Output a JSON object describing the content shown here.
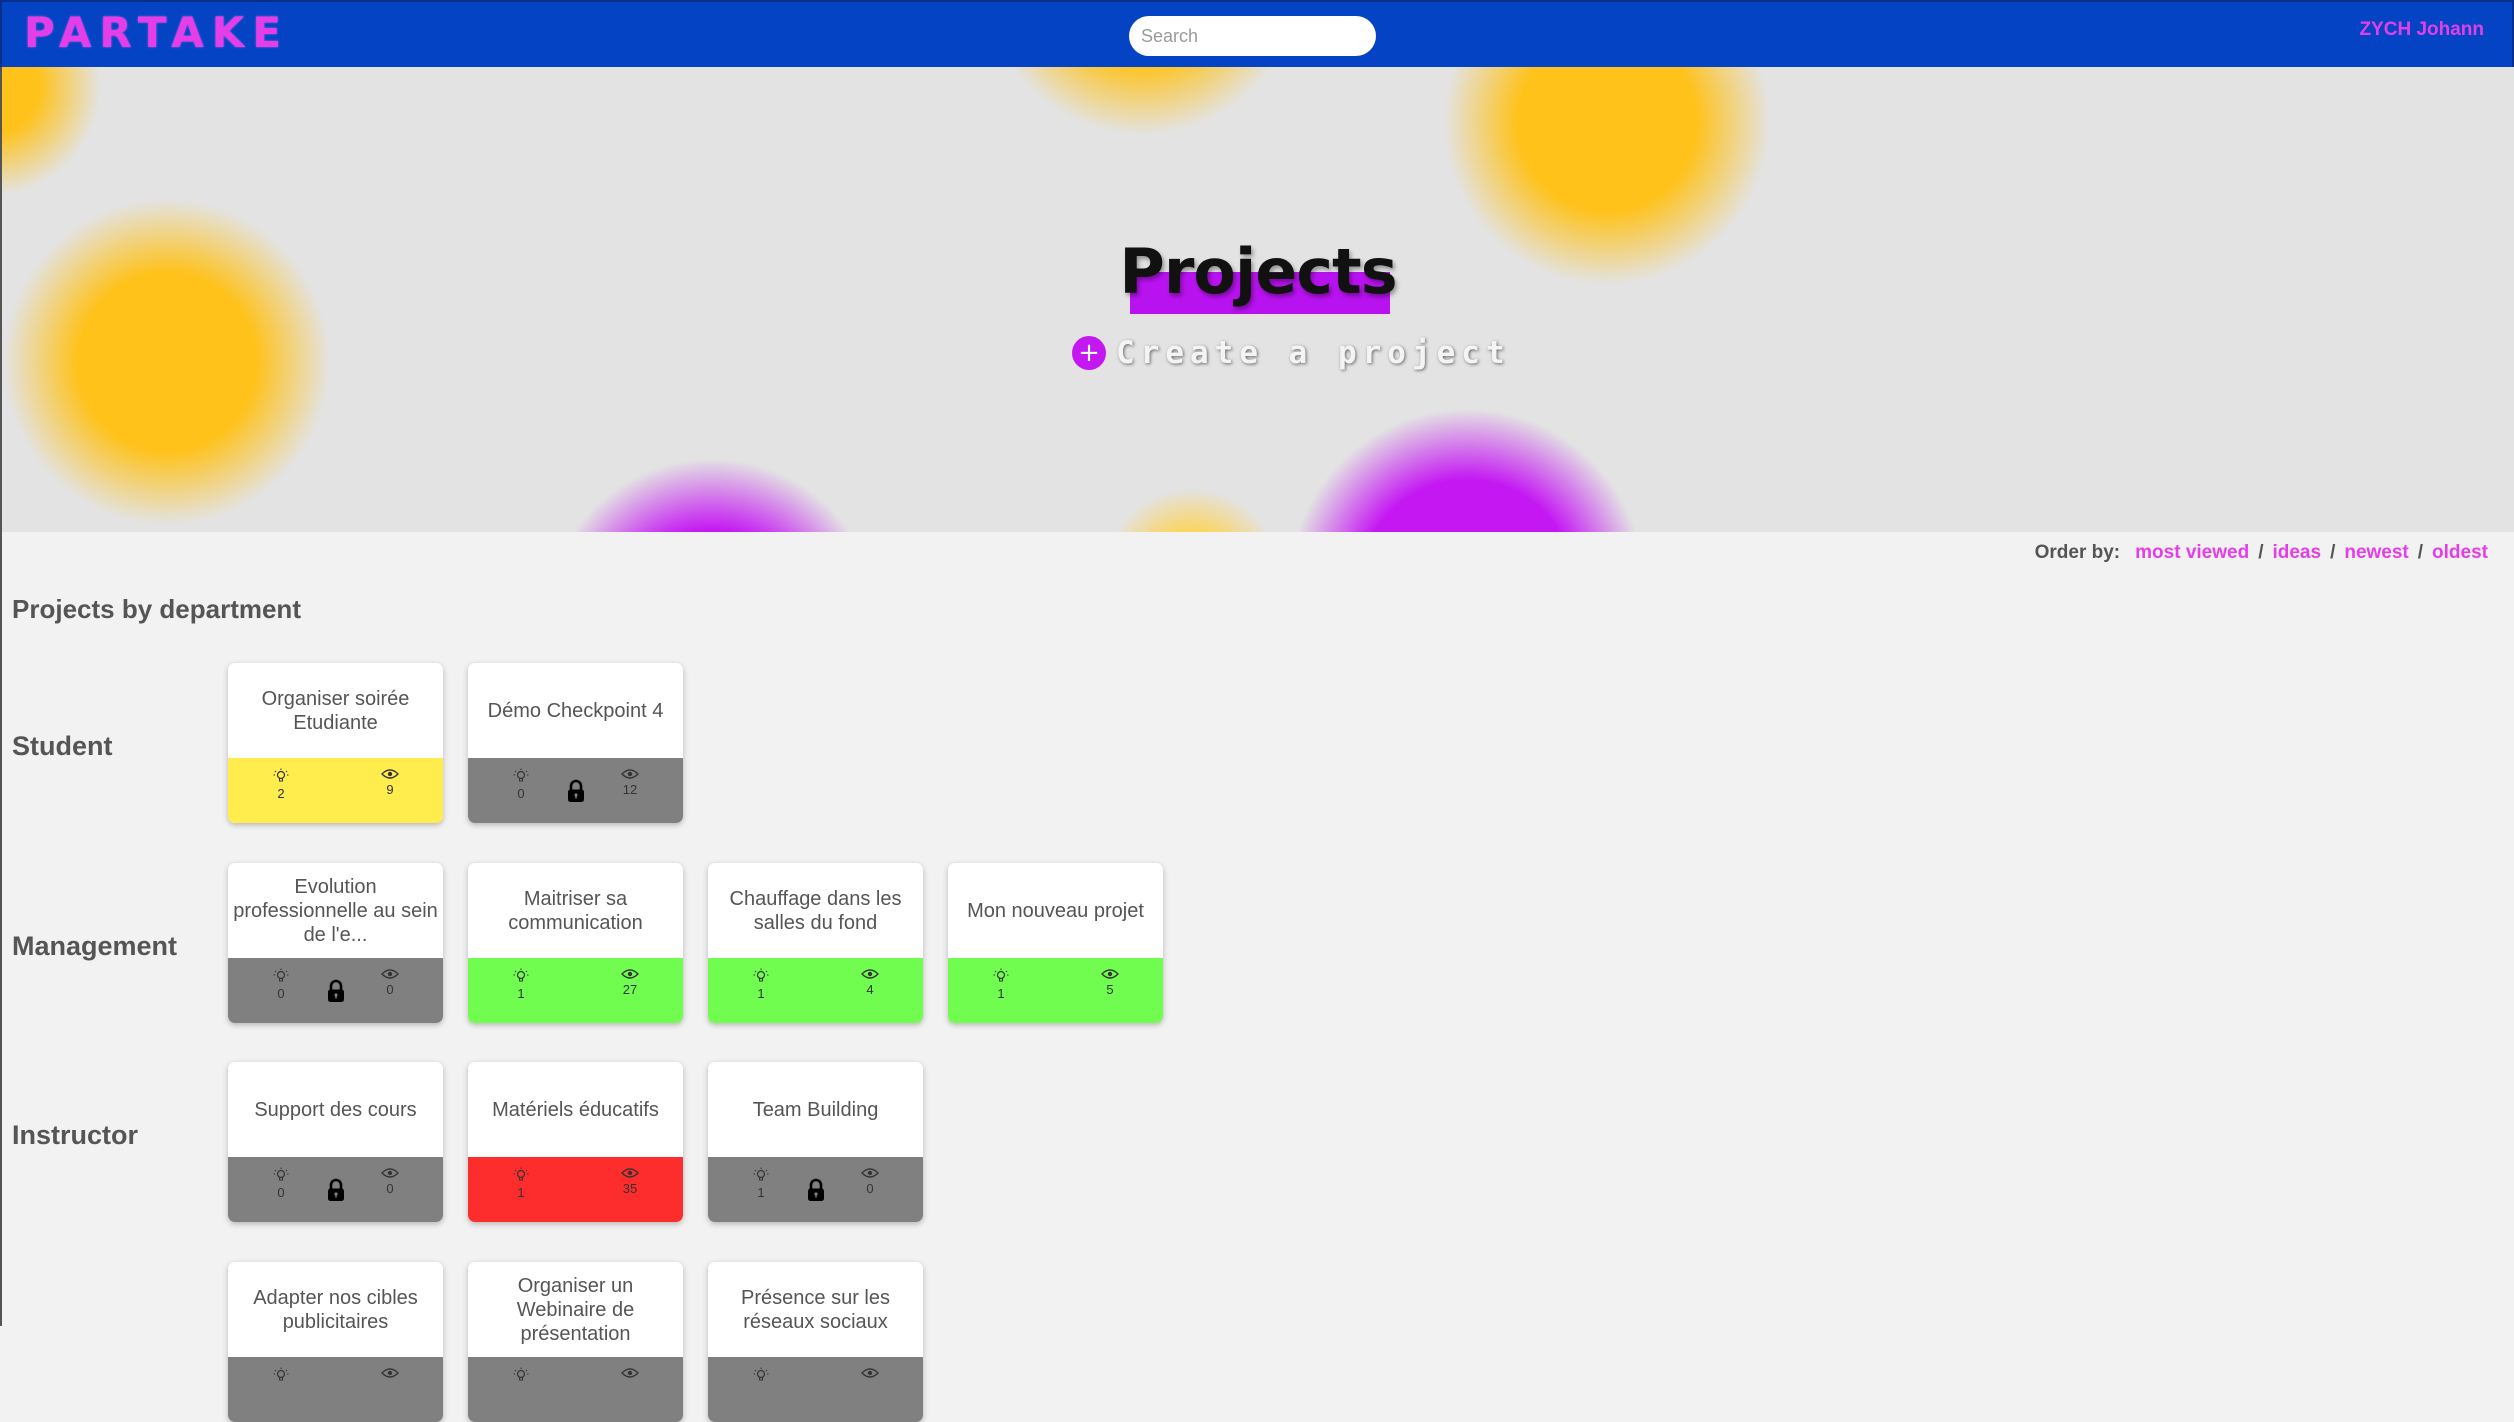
{
  "navbar": {
    "brand": "PARTAKE",
    "search_placeholder": "Search",
    "user": "ZYCH Johann",
    "color": "#0444c4",
    "accent": "#e53ee8"
  },
  "hero": {
    "title": "Projects",
    "create_label": "Create a project",
    "create_icon": "plus-circle-icon"
  },
  "order": {
    "label": "Order by:",
    "options": [
      "most viewed",
      "ideas",
      "newest",
      "oldest"
    ],
    "separator": "/"
  },
  "section_title": "Projects by department",
  "status_colors": {
    "yellow": "#ffec4d",
    "gray": "#808080",
    "green": "#70fd4f",
    "red": "#fd2d2d"
  },
  "departments": [
    {
      "name": "Student",
      "projects": [
        {
          "title": "Organiser soirée Etudiante",
          "ideas": "2",
          "views": "9",
          "status": "yellow",
          "locked": false
        },
        {
          "title": "Démo Checkpoint 4",
          "ideas": "0",
          "views": "12",
          "status": "gray",
          "locked": true
        }
      ]
    },
    {
      "name": "Management",
      "projects": [
        {
          "title": "Evolution professionnelle au sein de l'e...",
          "ideas": "0",
          "views": "0",
          "status": "gray",
          "locked": true
        },
        {
          "title": "Maitriser sa communication",
          "ideas": "1",
          "views": "27",
          "status": "green",
          "locked": false
        },
        {
          "title": "Chauffage dans les salles du fond",
          "ideas": "1",
          "views": "4",
          "status": "green",
          "locked": false
        },
        {
          "title": "Mon nouveau projet",
          "ideas": "1",
          "views": "5",
          "status": "green",
          "locked": false
        }
      ]
    },
    {
      "name": "Instructor",
      "projects": [
        {
          "title": "Support des cours",
          "ideas": "0",
          "views": "0",
          "status": "gray",
          "locked": true
        },
        {
          "title": "Matériels éducatifs",
          "ideas": "1",
          "views": "35",
          "status": "red",
          "locked": false
        },
        {
          "title": "Team Building",
          "ideas": "1",
          "views": "0",
          "status": "gray",
          "locked": true
        }
      ]
    },
    {
      "name": "",
      "projects": [
        {
          "title": "Adapter nos cibles publicitaires",
          "ideas": "",
          "views": "",
          "status": "gray",
          "locked": false
        },
        {
          "title": "Organiser un Webinaire de présentation",
          "ideas": "",
          "views": "",
          "status": "gray",
          "locked": false
        },
        {
          "title": "Présence sur les réseaux sociaux",
          "ideas": "",
          "views": "",
          "status": "gray",
          "locked": false
        }
      ]
    }
  ]
}
